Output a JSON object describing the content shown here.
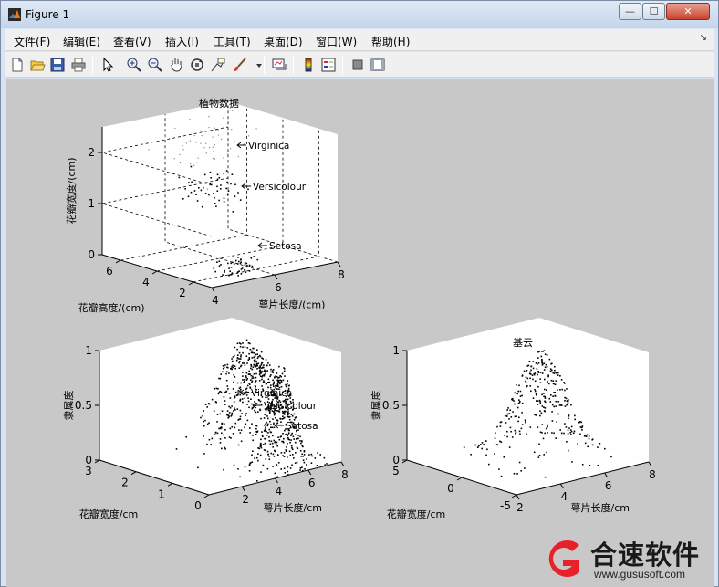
{
  "window": {
    "title": "Figure 1",
    "buttons": {
      "minimize": "—",
      "maximize": "☐",
      "close": "✕"
    }
  },
  "menubar": {
    "items": [
      "文件(F)",
      "编辑(E)",
      "查看(V)",
      "插入(I)",
      "工具(T)",
      "桌面(D)",
      "窗口(W)",
      "帮助(H)"
    ],
    "chevron": "↘"
  },
  "toolbar": {
    "icons": [
      "new-figure-icon",
      "open-file-icon",
      "save-icon",
      "print-icon",
      "edit-pointer-icon",
      "zoom-in-icon",
      "zoom-out-icon",
      "pan-hand-icon",
      "rotate-3d-icon",
      "data-cursor-icon",
      "brush-icon",
      "link-plot-icon",
      "colorbar-icon",
      "legend-icon",
      "hide-plot-tools-icon",
      "show-plot-tools-icon"
    ]
  },
  "colors": {
    "figure_bg": "#c8c8c8",
    "axes_bg": "#ffffff",
    "marker": "#000000",
    "watermark_red": "#e8202a"
  },
  "chart_data": [
    {
      "type": "scatter",
      "projection": "3d",
      "title": "植物数据",
      "xlabel": "萼片长度/(cm)",
      "ylabel": "花瓣高度/(cm)",
      "zlabel": "花瓣宽度/(cm)",
      "xlim": [
        4,
        8
      ],
      "ylim": [
        1,
        7
      ],
      "zlim": [
        0,
        2.5
      ],
      "xticks": [
        "4",
        "6",
        "8"
      ],
      "yticks": [
        "2",
        "4",
        "6"
      ],
      "zticks": [
        "0",
        "1",
        "2"
      ],
      "grid": true,
      "annotations": [
        "Virginica",
        "Versicolour",
        "Setosa"
      ],
      "series": [
        {
          "name": "Setosa",
          "x_mean": 5.0,
          "x_sd": 0.35,
          "y_mean": 1.46,
          "y_sd": 0.17,
          "z_mean": 0.25,
          "z_sd": 0.1,
          "n": 50,
          "shade": "dark"
        },
        {
          "name": "Versicolour",
          "x_mean": 5.9,
          "x_sd": 0.5,
          "y_mean": 4.26,
          "y_sd": 0.47,
          "z_mean": 1.33,
          "z_sd": 0.2,
          "n": 50,
          "shade": "dark"
        },
        {
          "name": "Virginica",
          "x_mean": 6.6,
          "x_sd": 0.6,
          "y_mean": 5.55,
          "y_sd": 0.55,
          "z_mean": 2.03,
          "z_sd": 0.27,
          "n": 50,
          "shade": "light"
        }
      ]
    },
    {
      "type": "scatter",
      "projection": "3d",
      "title": "",
      "xlabel": "萼片长度/cm",
      "ylabel": "花瓣宽度/cm",
      "zlabel": "隶属度",
      "xlim": [
        0,
        8
      ],
      "ylim": [
        0,
        3
      ],
      "zlim": [
        0,
        1
      ],
      "xticks": [
        "2",
        "4",
        "6",
        "8"
      ],
      "yticks": [
        "0",
        "1",
        "2",
        "3"
      ],
      "zticks": [
        "0",
        "0.5",
        "1"
      ],
      "grid": false,
      "annotations": [
        "Virginica",
        "Versicolour",
        "Setosa"
      ],
      "series": [
        {
          "name": "Virginica",
          "x_mean": 6.6,
          "x_sd": 1.0,
          "y_mean": 2.0,
          "y_sd": 0.6,
          "n": 280
        },
        {
          "name": "Versicolour",
          "x_mean": 5.9,
          "x_sd": 0.9,
          "y_mean": 1.3,
          "y_sd": 0.5,
          "n": 280
        },
        {
          "name": "Setosa",
          "x_mean": 5.0,
          "x_sd": 0.6,
          "y_mean": 0.3,
          "y_sd": 0.25,
          "n": 260
        }
      ]
    },
    {
      "type": "scatter",
      "projection": "3d",
      "title": "基云",
      "xlabel": "萼片长度/cm",
      "ylabel": "花瓣宽度/cm",
      "zlabel": "隶属度",
      "xlim": [
        2,
        8
      ],
      "ylim": [
        -5,
        5
      ],
      "zlim": [
        0,
        1
      ],
      "xticks": [
        "2",
        "4",
        "6",
        "8"
      ],
      "yticks": [
        "-5",
        "0",
        "5"
      ],
      "zticks": [
        "0",
        "0.5",
        "1"
      ],
      "grid": false,
      "series": [
        {
          "name": "",
          "x_mean": 5.8,
          "x_sd": 0.9,
          "y_mean": 0.5,
          "y_sd": 1.6,
          "n": 320
        }
      ]
    }
  ],
  "watermark": {
    "text": "合速软件",
    "url": "www.gususoft.com"
  }
}
